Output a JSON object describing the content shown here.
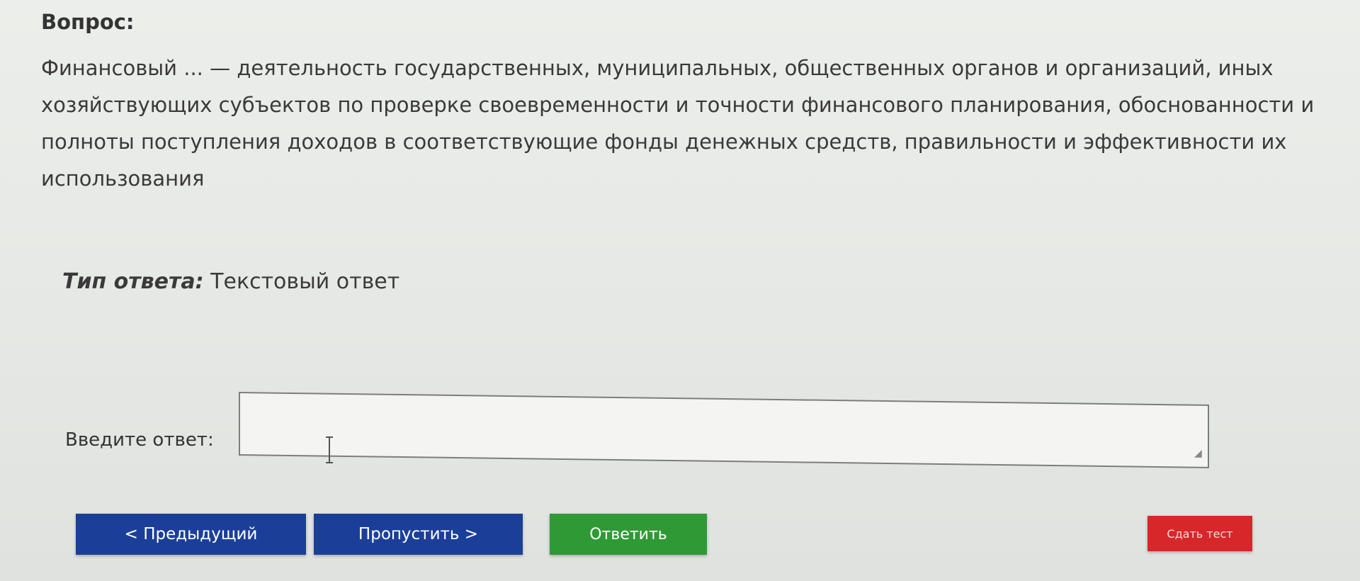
{
  "question": {
    "heading": "Вопрос:",
    "text": "Финансовый ... — деятельность государственных, муниципальных, общественных органов и организаций, иных хозяйствующих субъектов по проверке своевременности и точности финансового планирования, обоснованности и полноты поступления доходов в соответствующие фонды денежных средств, правильности и эффективности их использования"
  },
  "answer_type": {
    "label": "Тип ответа:",
    "value": "Текстовый ответ"
  },
  "answer": {
    "prompt": "Введите ответ:",
    "value": ""
  },
  "buttons": {
    "prev": "< Предыдущий",
    "skip": "Пропустить >",
    "answer": "Ответить",
    "finish": "Сдать тест"
  },
  "colors": {
    "nav_button": "#1b3f99",
    "answer_button": "#2f9a35",
    "finish_button": "#d7272b"
  },
  "icons": {
    "text_cursor": "text-cursor-icon",
    "resize": "resize-handle-icon"
  }
}
